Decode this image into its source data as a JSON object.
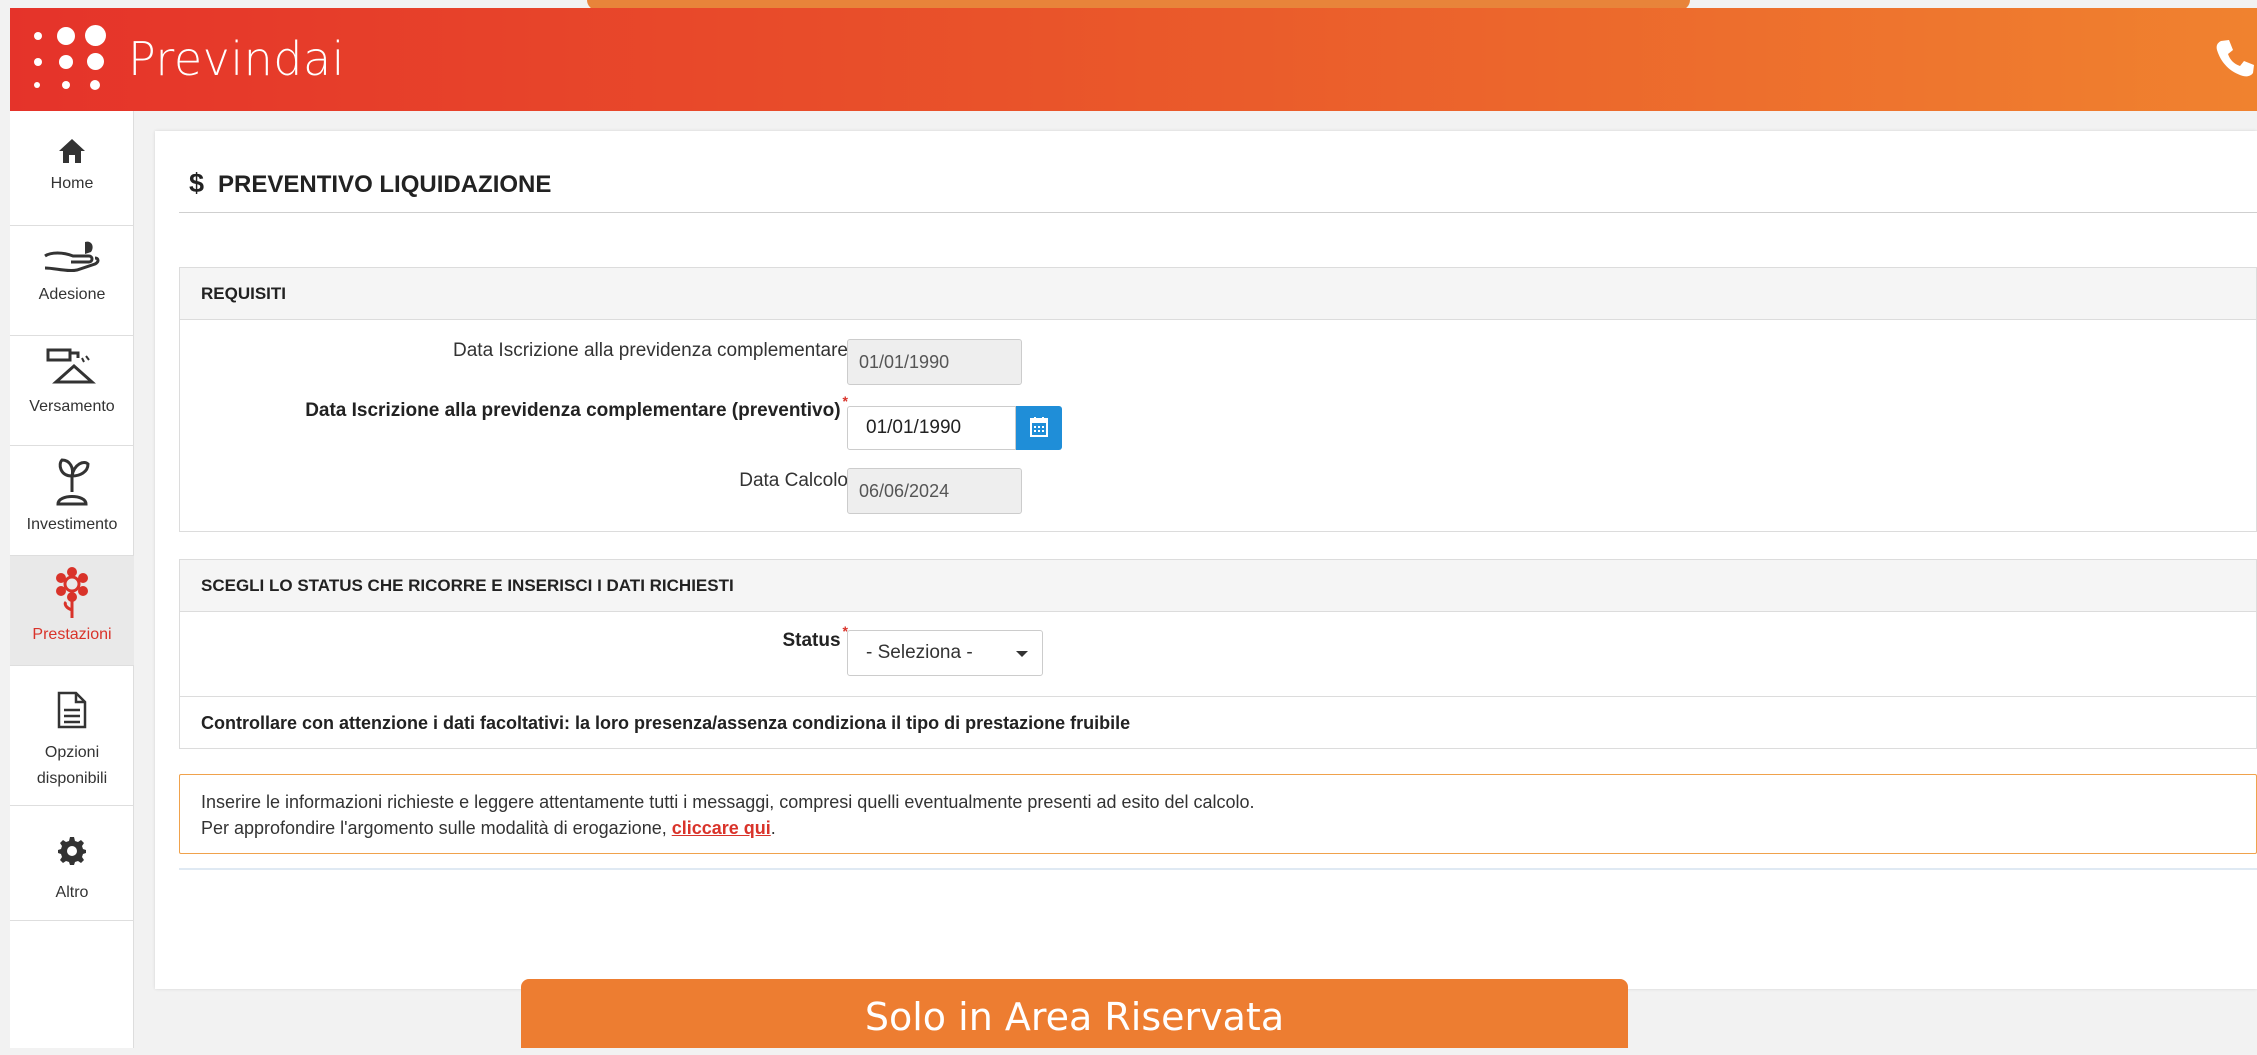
{
  "header": {
    "brand": "Previndai",
    "phone_icon": "phone-icon",
    "colors": {
      "start": "#e5332a",
      "end": "#f0822f"
    }
  },
  "sidebar": {
    "items": [
      {
        "label": "Home",
        "icon": "home-icon"
      },
      {
        "label": "Adesione",
        "icon": "hand-icon"
      },
      {
        "label": "Versamento",
        "icon": "deposit-icon"
      },
      {
        "label": "Investimento",
        "icon": "sprout-icon"
      },
      {
        "label": "Prestazioni",
        "icon": "flower-icon",
        "active": true
      },
      {
        "label": "Opzioni",
        "label2": "disponibili",
        "icon": "document-icon"
      },
      {
        "label": "Altro",
        "icon": "gear-icon"
      }
    ]
  },
  "main": {
    "title_symbol": "$",
    "title": "PREVENTIVO LIQUIDAZIONE",
    "requisiti": {
      "heading": "REQUISITI",
      "data_iscrizione_label": "Data Iscrizione alla previdenza complementare",
      "data_iscrizione_value": "01/01/1990",
      "data_iscrizione_prev_label": "Data Iscrizione alla previdenza complementare (preventivo)",
      "data_iscrizione_prev_value": "01/01/1990",
      "data_calcolo_label": "Data Calcolo",
      "data_calcolo_value": "06/06/2024",
      "required_mark": "*"
    },
    "status_section": {
      "heading": "SCEGLI LO STATUS CHE RICORRE E INSERISCI I DATI RICHIESTI",
      "status_label": "Status",
      "status_value": "- Seleziona -",
      "note": "Controllare con attenzione i dati facoltativi: la loro presenza/assenza condiziona il tipo di prestazione fruibile"
    },
    "info": {
      "line1": "Inserire le informazioni richieste e leggere attentamente tutti i messaggi, compresi quelli eventualmente presenti ad esito del calcolo.",
      "line2_prefix": "Per approfondire l'argomento sulle modalità di erogazione, ",
      "link": "cliccare qui",
      "line2_suffix": "."
    }
  },
  "banner": {
    "text": "Solo in Area Riservata"
  }
}
